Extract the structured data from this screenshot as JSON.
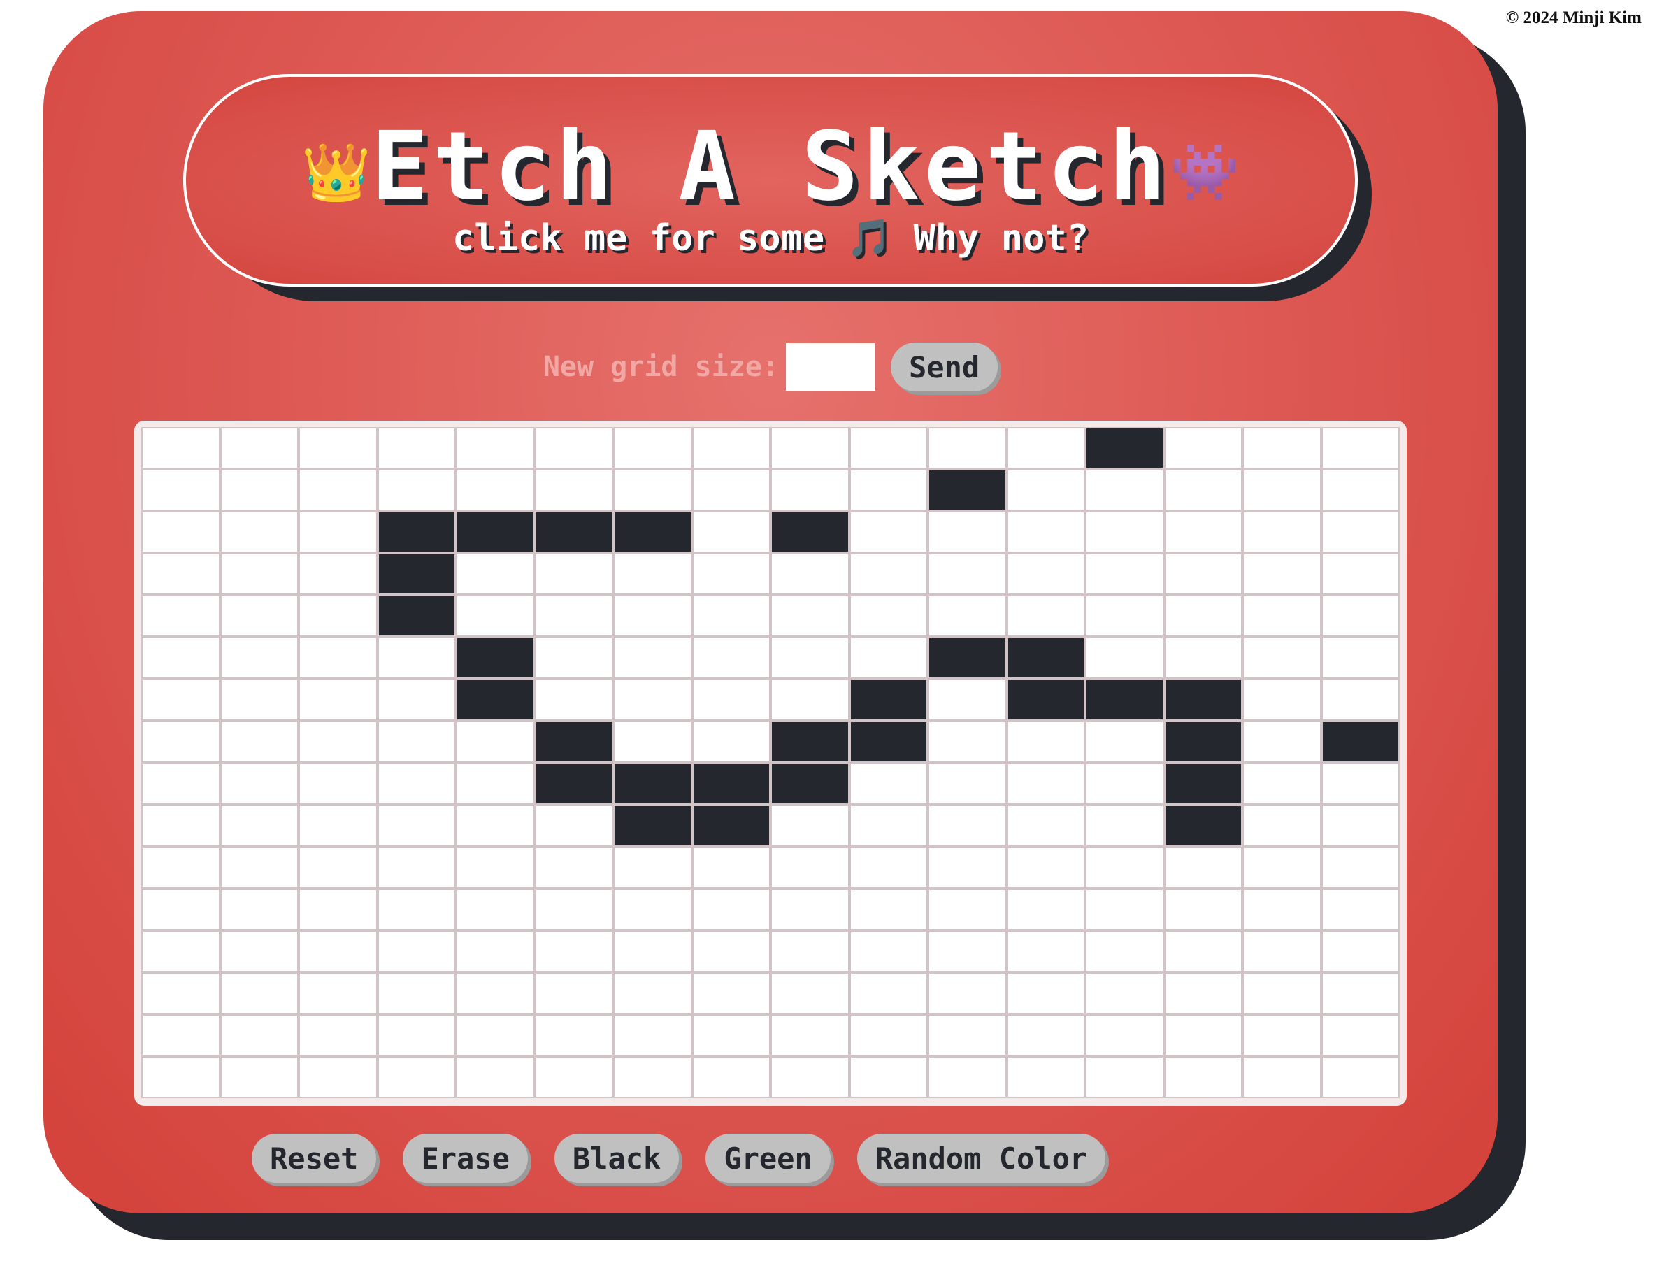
{
  "footer": {
    "copyright": "© 2024 Minji Kim"
  },
  "header": {
    "left_emoji": "👑",
    "title": "Etch A Sketch",
    "right_emoji": "👾",
    "subtitle": "click me for some 🎵 Why not?"
  },
  "controls": {
    "grid_size_label": "New grid size:",
    "grid_size_value": "",
    "send_label": "Send"
  },
  "grid": {
    "rows": 16,
    "cols": 16,
    "fill_color": "#24272e",
    "empty_color": "#ffffff",
    "filled_cells": [
      [
        0,
        12
      ],
      [
        1,
        10
      ],
      [
        2,
        3
      ],
      [
        2,
        4
      ],
      [
        2,
        5
      ],
      [
        2,
        6
      ],
      [
        2,
        8
      ],
      [
        3,
        3
      ],
      [
        4,
        3
      ],
      [
        5,
        4
      ],
      [
        5,
        10
      ],
      [
        5,
        11
      ],
      [
        6,
        4
      ],
      [
        6,
        9
      ],
      [
        6,
        11
      ],
      [
        6,
        12
      ],
      [
        6,
        13
      ],
      [
        7,
        5
      ],
      [
        7,
        8
      ],
      [
        7,
        9
      ],
      [
        7,
        13
      ],
      [
        7,
        15
      ],
      [
        8,
        5
      ],
      [
        8,
        6
      ],
      [
        8,
        7
      ],
      [
        8,
        8
      ],
      [
        8,
        13
      ],
      [
        9,
        6
      ],
      [
        9,
        7
      ],
      [
        9,
        13
      ]
    ]
  },
  "actions": {
    "reset_label": "Reset",
    "erase_label": "Erase",
    "black_label": "Black",
    "green_label": "Green",
    "random_label": "Random Color"
  },
  "colors": {
    "frame_red": "#d9504a",
    "shadow_dark": "#24272e",
    "button_gray": "#c0c0c0"
  }
}
